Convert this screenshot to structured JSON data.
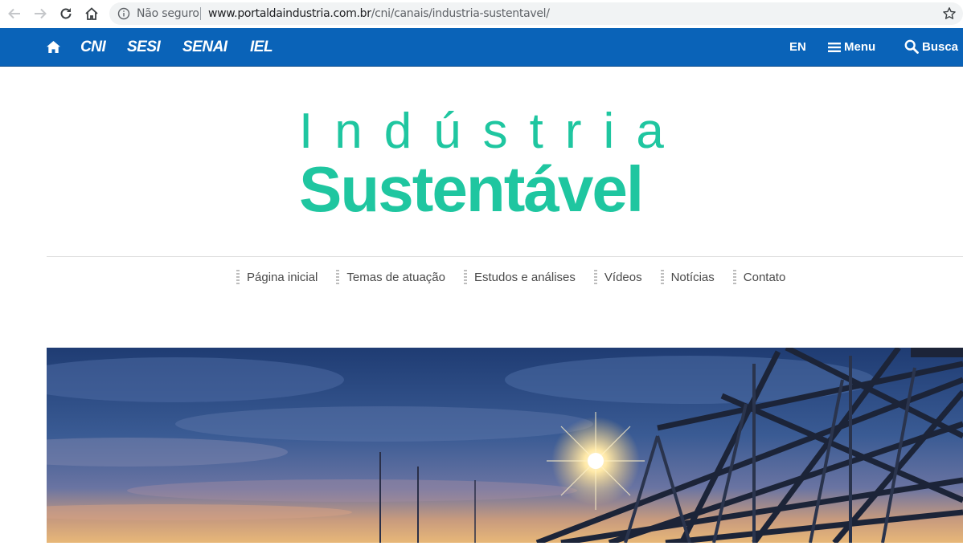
{
  "browser": {
    "security_label": "Não seguro",
    "url_host": "www.portaldaindustria.com.br",
    "url_path": "/cni/canais/industria-sustentavel/"
  },
  "topbar": {
    "brands": [
      "CNI",
      "SESI",
      "SENAI",
      "IEL"
    ],
    "lang": "EN",
    "menu_label": "Menu",
    "search_label": "Busca"
  },
  "hero_title": {
    "line1": "Indústria",
    "line2": "Sustentável"
  },
  "subnav": {
    "items": [
      "Página inicial",
      "Temas de atuação",
      "Estudos e análises",
      "Vídeos",
      "Notícias",
      "Contato"
    ]
  },
  "colors": {
    "topbar_blue": "#0a63b8",
    "title_green": "#1fc6a0"
  },
  "icons": [
    "back-arrow-icon",
    "forward-arrow-icon",
    "reload-icon",
    "home-icon",
    "info-icon",
    "star-icon",
    "hamburger-icon",
    "search-icon"
  ]
}
